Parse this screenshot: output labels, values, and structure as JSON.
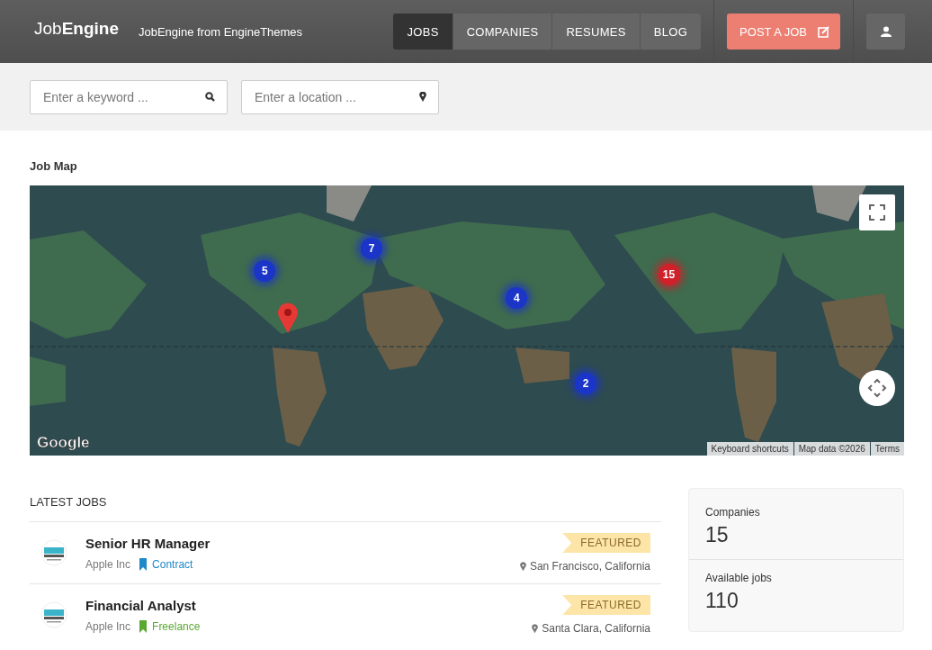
{
  "header": {
    "logo_light": "Job",
    "logo_bold": "Engine",
    "tagline": "JobEngine from EngineThemes",
    "nav": [
      {
        "label": "JOBS",
        "selected": true
      },
      {
        "label": "COMPANIES",
        "selected": false
      },
      {
        "label": "RESUMES",
        "selected": false
      },
      {
        "label": "BLOG",
        "selected": false
      }
    ],
    "post_button": "POST A JOB"
  },
  "search": {
    "keyword": {
      "placeholder": "Enter a keyword ..."
    },
    "location": {
      "placeholder": "Enter a location ..."
    }
  },
  "map": {
    "title": "Job Map",
    "clusters": [
      {
        "count": "5",
        "color": "#1a35c8"
      },
      {
        "count": "7",
        "color": "#1a35c8"
      },
      {
        "count": "4",
        "color": "#1a35c8"
      },
      {
        "count": "15",
        "color": "#d0202a"
      },
      {
        "count": "2",
        "color": "#1a35c8"
      }
    ],
    "logo": "Google",
    "attribution": [
      "Keyboard shortcuts",
      "Map data ©2026",
      "Terms"
    ]
  },
  "latest_jobs": {
    "title": "LATEST JOBS",
    "jobs": [
      {
        "title": "Senior HR Manager",
        "company": "Apple Inc",
        "type": "Contract",
        "color": "#1e88c8",
        "badge": "FEATURED",
        "location": "San Francisco, California"
      },
      {
        "title": "Financial Analyst",
        "company": "Apple Inc",
        "type": "Freelance",
        "color": "#5aa832",
        "badge": "FEATURED",
        "location": "Santa Clara, California"
      }
    ]
  },
  "stats": [
    {
      "label": "Companies",
      "value": "15"
    },
    {
      "label": "Available jobs",
      "value": "110"
    }
  ]
}
